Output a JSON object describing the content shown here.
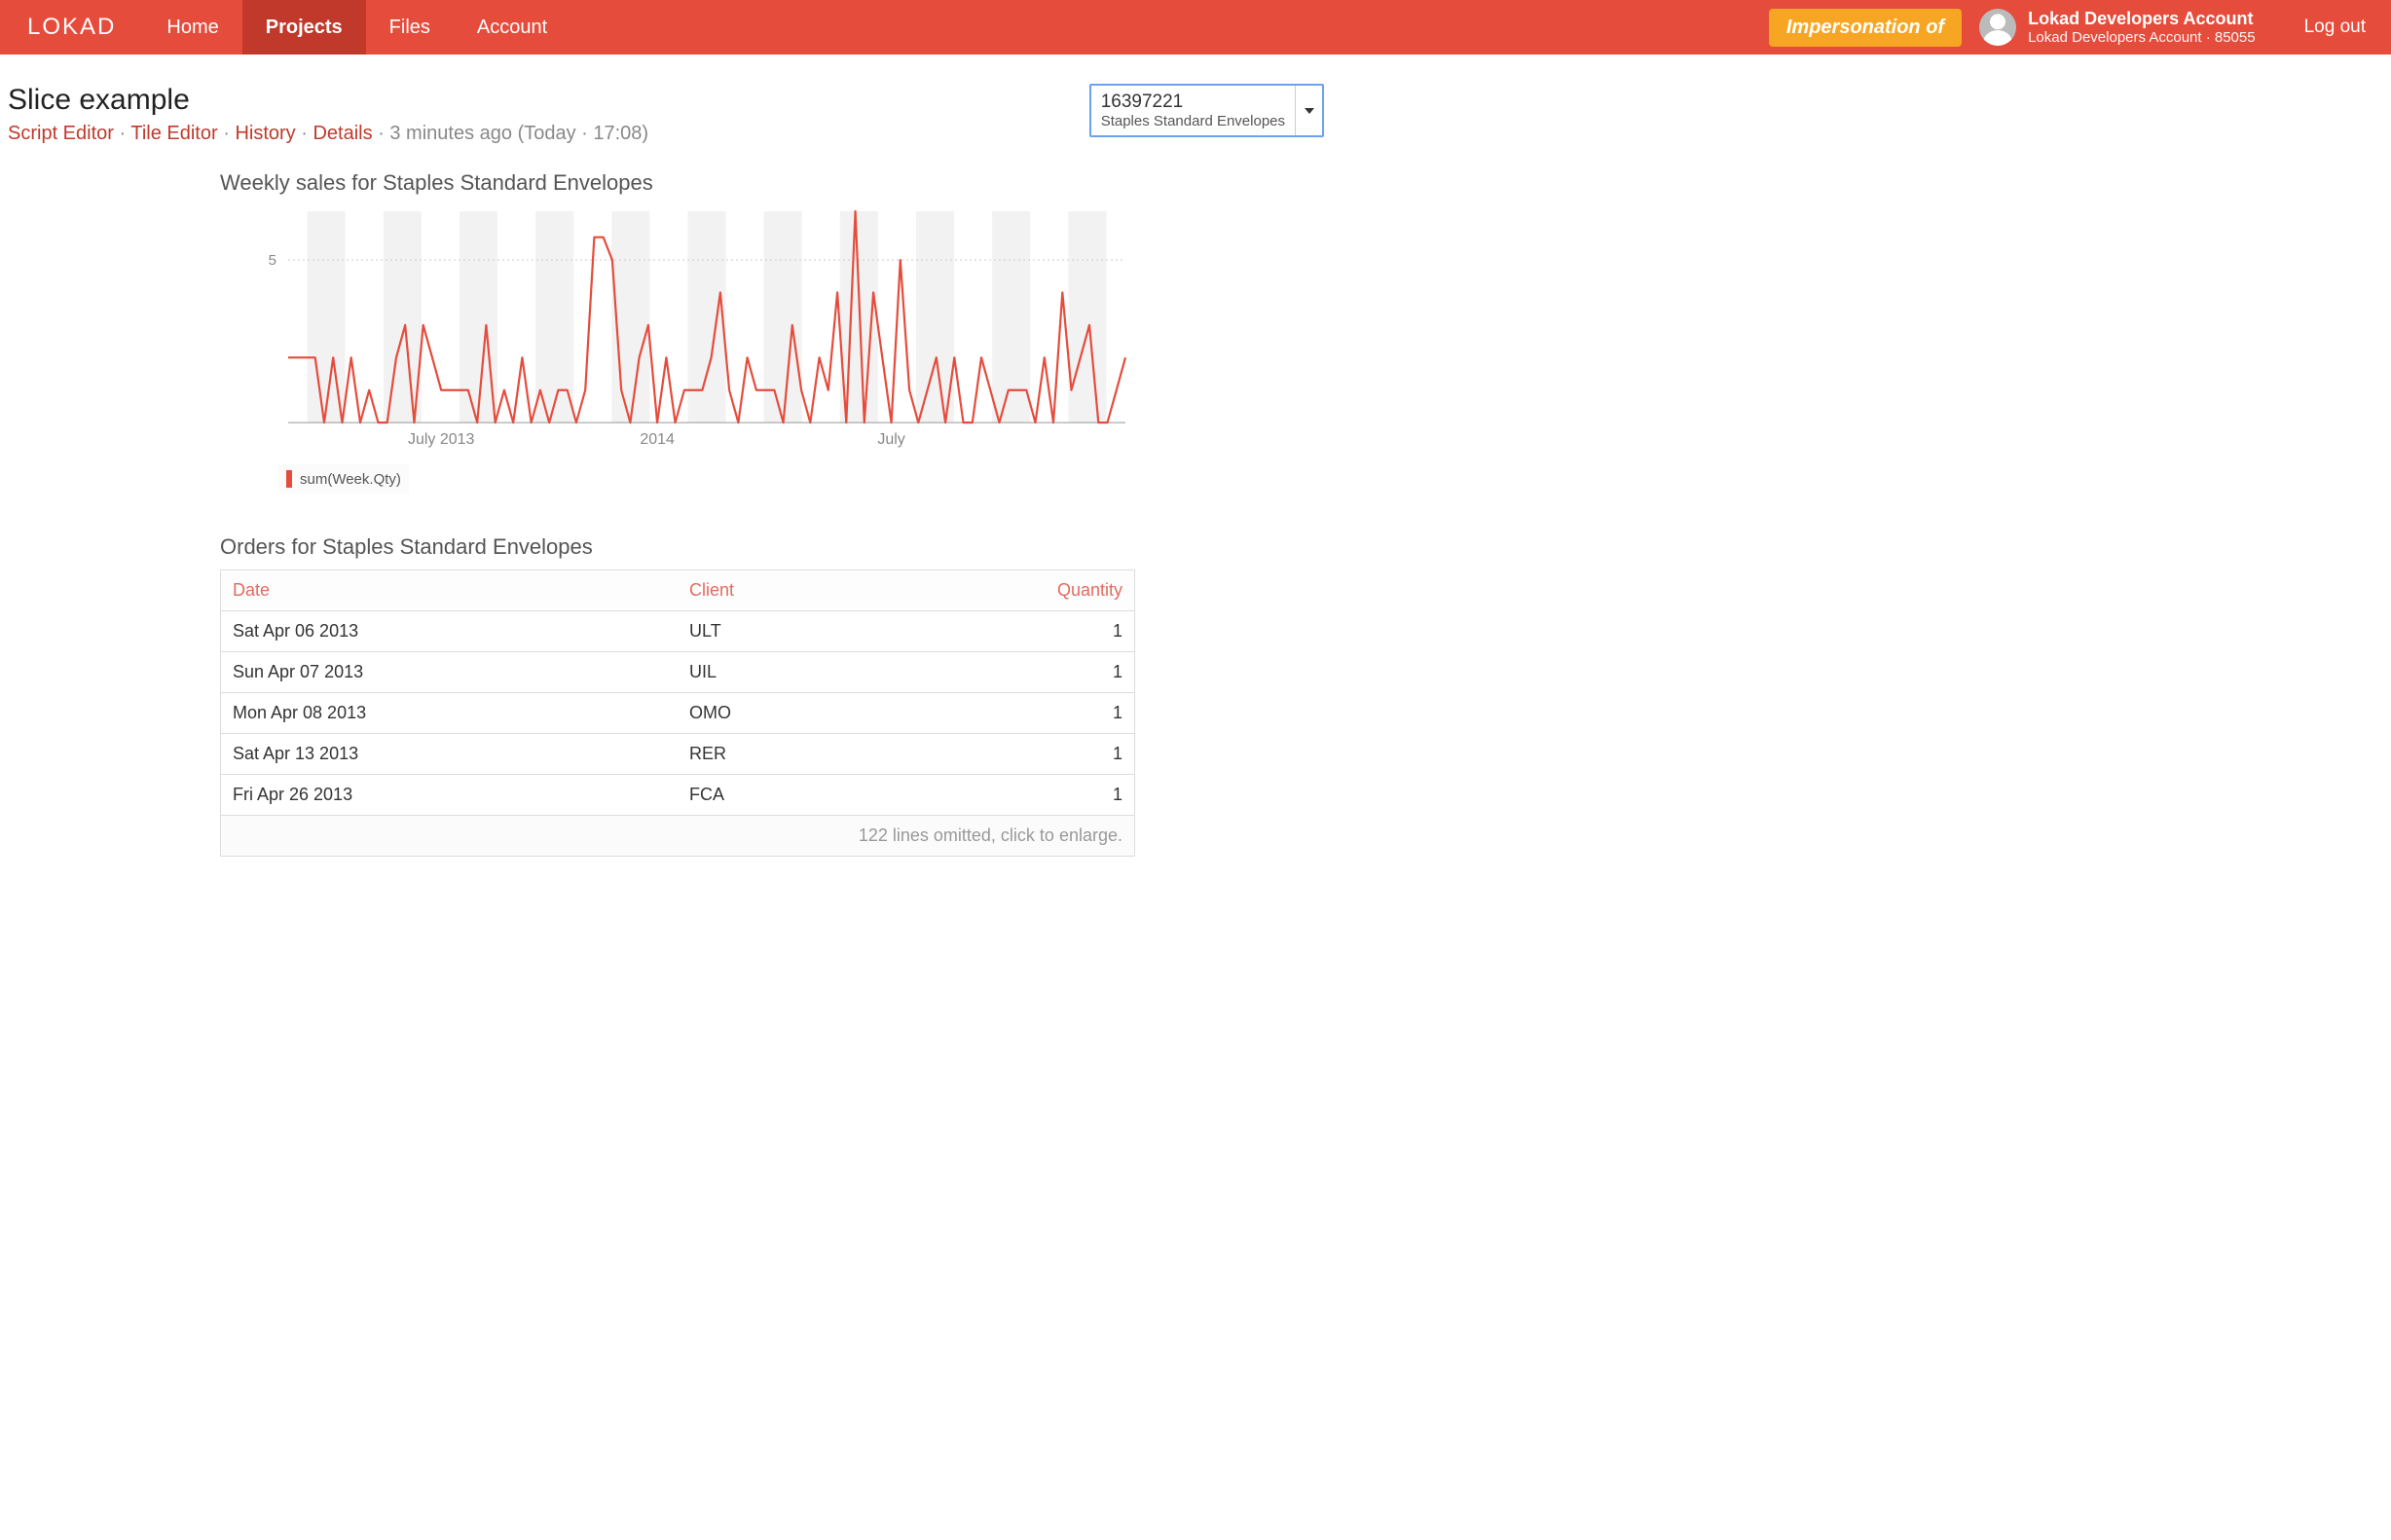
{
  "colors": {
    "accent": "#e54c3c",
    "accent_dark": "#c0392b",
    "orange": "#f6a623"
  },
  "header": {
    "brand": "LOKAD",
    "nav": [
      {
        "label": "Home",
        "active": false
      },
      {
        "label": "Projects",
        "active": true
      },
      {
        "label": "Files",
        "active": false
      },
      {
        "label": "Account",
        "active": false
      }
    ],
    "impersonation": "Impersonation of",
    "user": {
      "name": "Lokad Developers Account",
      "subtitle": "Lokad Developers Account · 85055"
    },
    "logout": "Log out"
  },
  "page": {
    "title": "Slice example",
    "crumbs": {
      "links": [
        "Script Editor",
        "Tile Editor",
        "History",
        "Details"
      ],
      "sep": " · ",
      "meta": "3 minutes ago (Today · 17:08)"
    },
    "slice_selector": {
      "id": "16397221",
      "label": "Staples Standard Envelopes"
    }
  },
  "chart": {
    "title": "Weekly sales for Staples Standard Envelopes",
    "legend": "sum(Week.Qty)"
  },
  "chart_data": {
    "type": "line",
    "title": "Weekly sales for Staples Standard Envelopes",
    "xlabel": "",
    "ylabel": "",
    "ylim": [
      0,
      6.5
    ],
    "y_ticks": [
      5
    ],
    "x_ticks": [
      "July 2013",
      "2014",
      "July"
    ],
    "x_tick_positions": [
      17,
      41,
      67
    ],
    "series": [
      {
        "name": "sum(Week.Qty)",
        "values": [
          2,
          2,
          2,
          2,
          0,
          2,
          0,
          2,
          0,
          1,
          0,
          0,
          2,
          3,
          0,
          3,
          2,
          1,
          1,
          1,
          1,
          0,
          3,
          0,
          1,
          0,
          2,
          0,
          1,
          0,
          1,
          1,
          0,
          1,
          5.7,
          5.7,
          5,
          1,
          0,
          2,
          3,
          0,
          2,
          0,
          1,
          1,
          1,
          2,
          4,
          1,
          0,
          2,
          1,
          1,
          1,
          0,
          3,
          1,
          0,
          2,
          1,
          4,
          0,
          6.5,
          0,
          4,
          2,
          0,
          5,
          1,
          0,
          1,
          2,
          0,
          2,
          0,
          0,
          2,
          1,
          0,
          1,
          1,
          1,
          0,
          2,
          0,
          4,
          1,
          2,
          3,
          0,
          0,
          1,
          2
        ]
      }
    ]
  },
  "orders": {
    "title": "Orders for Staples Standard Envelopes",
    "columns": [
      "Date",
      "Client",
      "Quantity"
    ],
    "rows": [
      {
        "date": "Sat Apr 06 2013",
        "client": "ULT",
        "qty": "1"
      },
      {
        "date": "Sun Apr 07 2013",
        "client": "UIL",
        "qty": "1"
      },
      {
        "date": "Mon Apr 08 2013",
        "client": "OMO",
        "qty": "1"
      },
      {
        "date": "Sat Apr 13 2013",
        "client": "RER",
        "qty": "1"
      },
      {
        "date": "Fri Apr 26 2013",
        "client": "FCA",
        "qty": "1"
      }
    ],
    "footer": "122 lines omitted, click to enlarge."
  }
}
